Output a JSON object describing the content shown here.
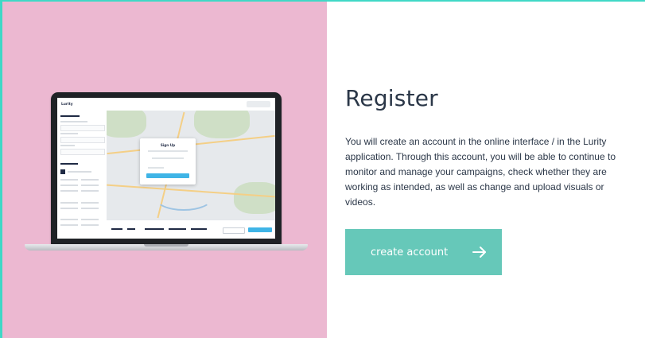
{
  "illustration": {
    "app_logo": "Lurity",
    "modal_title": "Sign Up"
  },
  "register": {
    "title": "Register",
    "description": "You will create an account in the online interface / in the Lurity application. Through this account, you will be able to continue to monitor and manage your campaigns, check whether they are working as intended, as well as change and upload visuals or videos.",
    "button_label": "create account",
    "arrow_icon": "arrow-right-icon"
  },
  "colors": {
    "accent_border": "#3fd8c6",
    "left_background": "#ecb8d1",
    "button_background": "#66c8b9",
    "text": "#2b3748"
  }
}
